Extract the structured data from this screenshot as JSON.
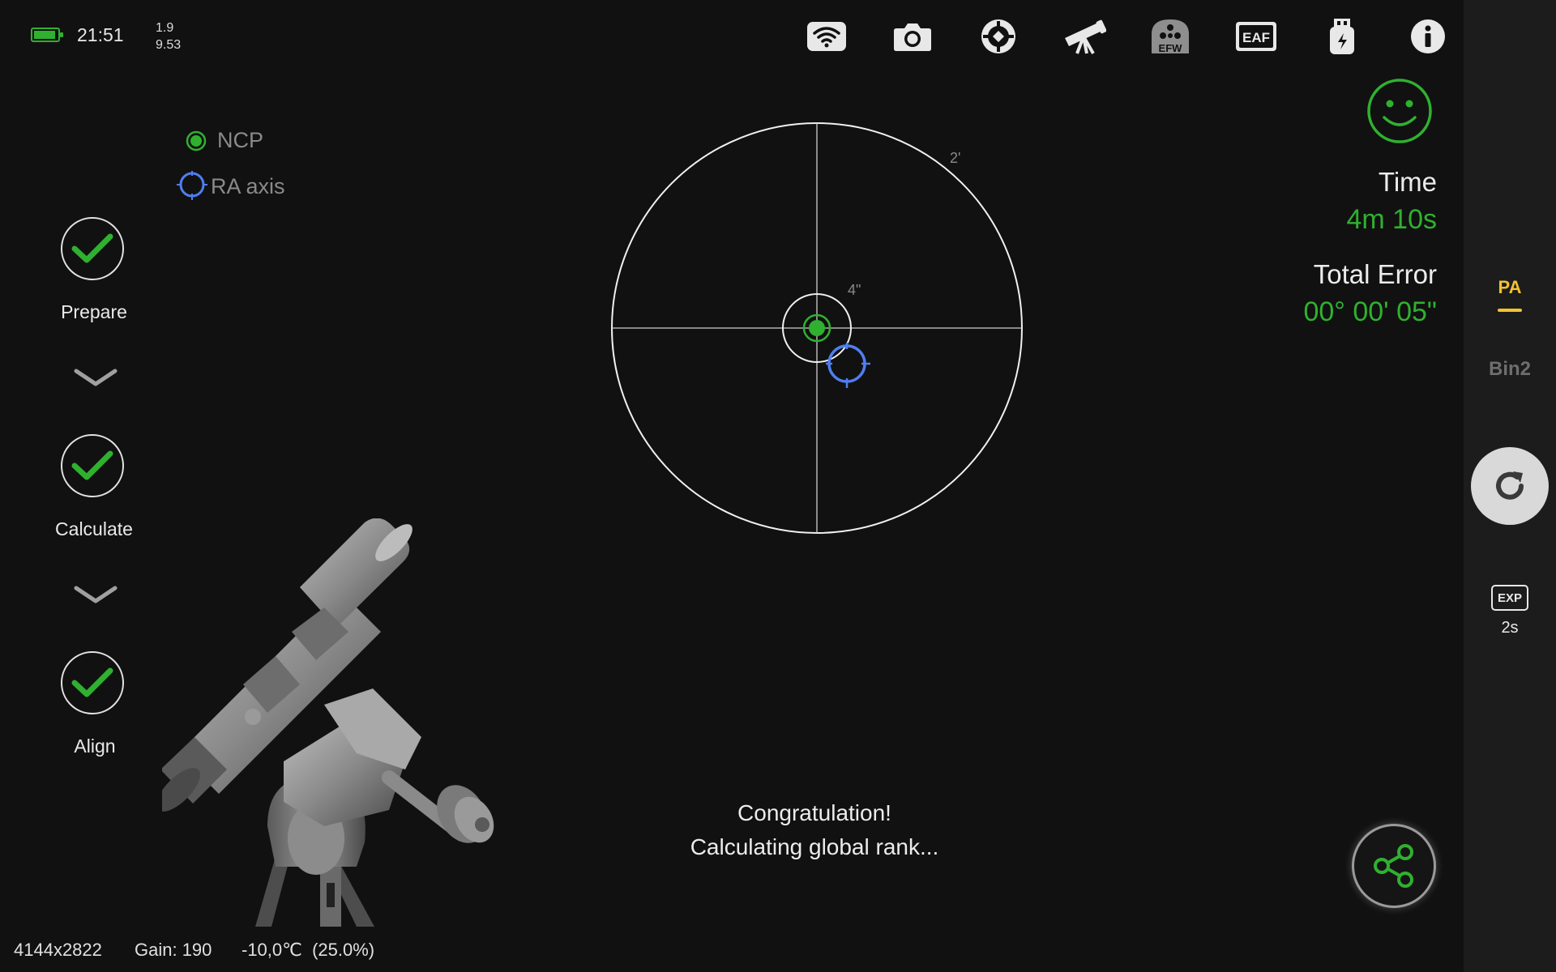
{
  "status_bar": {
    "time": "21:51",
    "version_line1": "1.9",
    "version_line2": "9.53",
    "battery_level": 0.9
  },
  "toolbar_icons": [
    "wifi-icon",
    "camera-icon",
    "guide-crosshair-icon",
    "telescope-icon",
    "efw-filter-wheel-icon",
    "eaf-focuser-icon",
    "usb-storage-icon",
    "info-icon"
  ],
  "toolbar_labels": {
    "efw": "EFW",
    "eaf": "EAF"
  },
  "legend": {
    "ncp": "NCP",
    "ra_axis": "RA axis"
  },
  "target": {
    "outer_ring_label": "2'",
    "inner_ring_label": "4\""
  },
  "steps": [
    {
      "label": "Prepare",
      "done": true
    },
    {
      "label": "Calculate",
      "done": true
    },
    {
      "label": "Align",
      "done": true
    }
  ],
  "info": {
    "time_label": "Time",
    "time_value": "4m 10s",
    "error_label": "Total Error",
    "error_value": "00° 00' 05\""
  },
  "message": {
    "line1": "Congratulation!",
    "line2": "Calculating global rank..."
  },
  "sidebar": {
    "mode": "PA",
    "bin": "Bin2",
    "exp_badge": "EXP",
    "exp_value": "2s"
  },
  "bottom_bar": {
    "resolution": "4144x2822",
    "gain": "Gain: 190",
    "temperature": "-10,0℃  (25.0%)"
  },
  "colors": {
    "accent_green": "#2fb12f",
    "ra_blue": "#4f7ef0",
    "mode_yellow": "#f2c230",
    "background": "#111111"
  }
}
